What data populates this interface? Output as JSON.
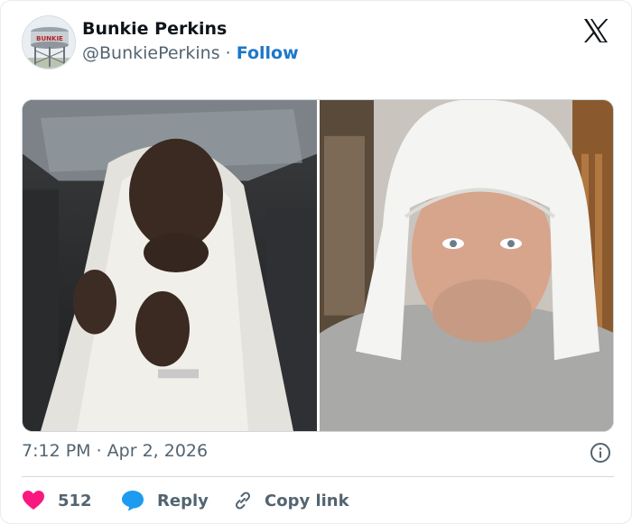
{
  "author": {
    "name": "Bunkie Perkins",
    "handle": "@BunkiePerkins",
    "separator": "·",
    "follow_label": "Follow",
    "avatar_text": "BUNKIE"
  },
  "platform": {
    "icon": "x-logo-icon"
  },
  "media": {
    "images": [
      {
        "description_icon": "photo-icon",
        "subject": "man wrapped in white blanket in car"
      },
      {
        "description_icon": "photo-icon",
        "subject": "man with white towel on head"
      }
    ]
  },
  "meta": {
    "timestamp": "7:12 PM · Apr 2, 2026",
    "info_icon": "info-icon"
  },
  "actions": {
    "like_count": "512",
    "like_icon": "heart-icon",
    "like_color": "#f91880",
    "reply_label": "Reply",
    "reply_icon": "speech-bubble-icon",
    "reply_color": "#1d9bf0",
    "copy_label": "Copy link",
    "copy_icon": "link-icon"
  }
}
